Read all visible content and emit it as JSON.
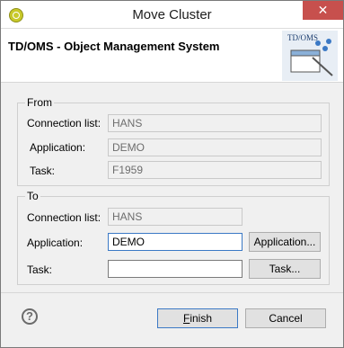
{
  "window": {
    "title": "Move Cluster",
    "close_glyph": "✕"
  },
  "header": {
    "title": "TD/OMS - Object Management System",
    "logo_text": "TD/OMS"
  },
  "from": {
    "label": "From",
    "connection_label": "Connection list:",
    "connection_value": "HANS",
    "application_label": "Application:",
    "application_value": "DEMO",
    "task_label": "Task:",
    "task_value": "F1959"
  },
  "to": {
    "label": "To",
    "connection_label": "Connection list:",
    "connection_value": "HANS",
    "application_label": "Application:",
    "application_value": "DEMO",
    "application_button": "Application...",
    "task_label": "Task:",
    "task_value": "",
    "task_button": "Task..."
  },
  "footer": {
    "help_glyph": "?",
    "finish_first": "F",
    "finish_rest": "inish",
    "cancel_label": "Cancel"
  },
  "colors": {
    "accent": "#3b79c5",
    "close": "#c7504d",
    "icon": "#c8c92a"
  }
}
